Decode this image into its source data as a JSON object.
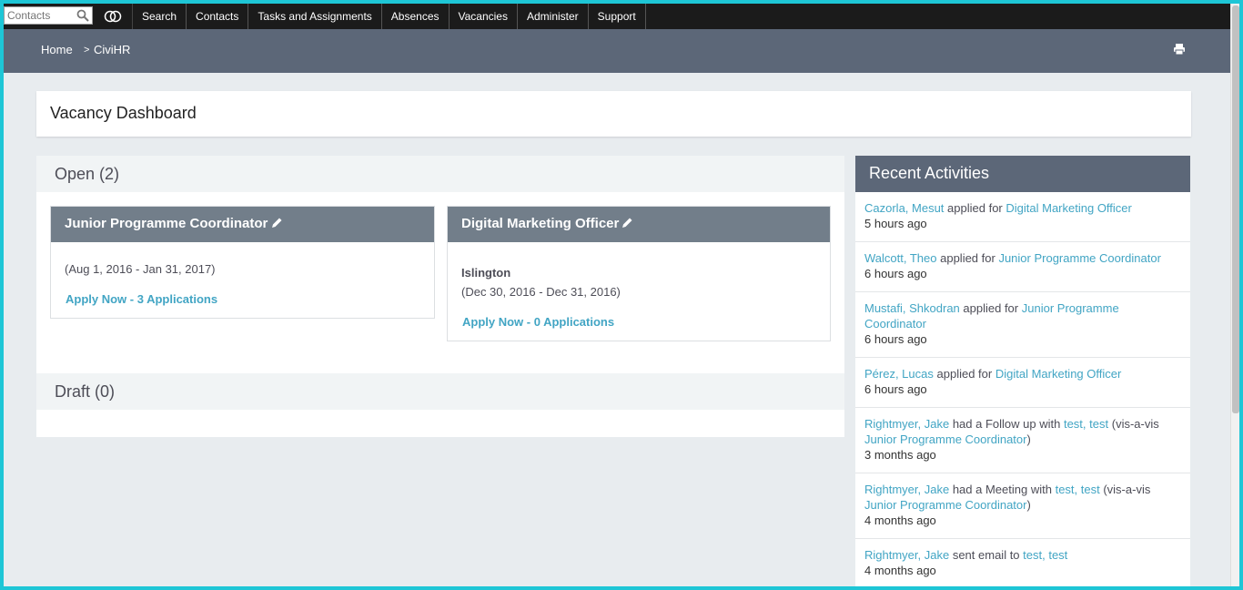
{
  "menu": {
    "search_placeholder": "Contacts",
    "items": [
      "Search",
      "Contacts",
      "Tasks and Assignments",
      "Absences",
      "Vacancies",
      "Administer",
      "Support"
    ]
  },
  "breadcrumb": {
    "home": "Home",
    "separator": ">",
    "current": "CiviHR"
  },
  "page_title": "Vacancy Dashboard",
  "open_section": {
    "label": "Open (2)",
    "vacancies": [
      {
        "title": "Junior Programme Coordinator",
        "location": "",
        "dates": "(Aug 1, 2016 - Jan 31, 2017)",
        "apply": "Apply Now - 3 Applications"
      },
      {
        "title": "Digital Marketing Officer",
        "location": "Islington",
        "dates": "(Dec 30, 2016 - Dec 31, 2016)",
        "apply": "Apply Now - 0 Applications"
      }
    ]
  },
  "draft_section": {
    "label": "Draft (0)"
  },
  "activities": {
    "title": "Recent Activities",
    "items": [
      {
        "who": "Cazorla, Mesut",
        "verb": "applied for",
        "target": "Digital Marketing Officer",
        "time": "5 hours ago"
      },
      {
        "who": "Walcott, Theo",
        "verb": "applied for",
        "target": "Junior Programme Coordinator",
        "time": "6 hours ago"
      },
      {
        "who": "Mustafi, Shkodran",
        "verb": "applied for",
        "target": "Junior Programme Coordinator",
        "time": "6 hours ago"
      },
      {
        "who": "Pérez, Lucas",
        "verb": "applied for",
        "target": "Digital Marketing Officer",
        "time": "6 hours ago"
      },
      {
        "who": "Rightmyer, Jake",
        "verb": "had a Follow up with",
        "target": "test, test",
        "vis_prefix": "(vis-a-vis",
        "vis_target": "Junior Programme Coordinator",
        "vis_suffix": ")",
        "time": "3 months ago"
      },
      {
        "who": "Rightmyer, Jake",
        "verb": "had a Meeting with",
        "target": "test, test",
        "vis_prefix": "(vis-a-vis",
        "vis_target": "Junior Programme Coordinator",
        "vis_suffix": ")",
        "time": "4 months ago"
      },
      {
        "who": "Rightmyer, Jake",
        "verb": "sent email to",
        "target": "test, test",
        "time": "4 months ago"
      }
    ]
  },
  "icons": {
    "search": "magnifier-icon",
    "logo": "civicrm-logo-icon",
    "print": "printer-icon",
    "edit": "pencil-icon"
  },
  "colors": {
    "menubar": "#1b1b1b",
    "header": "#5c6778",
    "card_header": "#727e8a",
    "link": "#42a5c4",
    "page_bg": "#e8ecef",
    "frame": "#1ec6d6"
  }
}
